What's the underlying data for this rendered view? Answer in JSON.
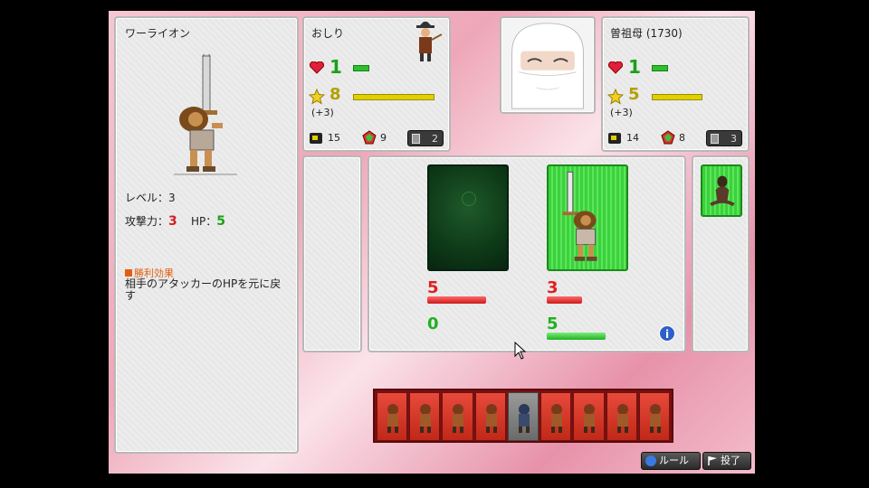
{
  "detail": {
    "card_name": "ワーライオン",
    "level_label": "レベル：",
    "level_value": "3",
    "attack_label": "攻撃力：",
    "attack_value": "3",
    "hp_label": "HP：",
    "hp_value": "5",
    "effect_title": "勝利効果",
    "effect_text": "相手のアタッカーのHPを元に戻す"
  },
  "player1": {
    "name": "おしり",
    "hp": "1",
    "hp_fraction": 0.2,
    "stars": "8",
    "star_fraction": 1.0,
    "bonus": "(+3)",
    "deck_count": "15",
    "gem_count": "9",
    "hand_count": "2"
  },
  "player2": {
    "name": "曽祖母 (1730)",
    "hp": "1",
    "hp_fraction": 0.2,
    "stars": "5",
    "star_fraction": 0.62,
    "bonus": "(+3)",
    "deck_count": "14",
    "gem_count": "8",
    "hand_count": "3"
  },
  "battle": {
    "left_attack": "5",
    "left_attack_fraction": 0.5,
    "left_hp": "0",
    "left_hp_fraction": 0.0,
    "right_attack": "3",
    "right_attack_fraction": 0.3,
    "right_hp": "5",
    "right_hp_fraction": 0.5,
    "info": "i"
  },
  "hand": {
    "cards": [
      "red",
      "red",
      "red",
      "red",
      "gray",
      "red",
      "red",
      "red",
      "red"
    ]
  },
  "buttons": {
    "rules": "ルール",
    "surrender": "投了"
  },
  "colors": {
    "hp": "#1aa01a",
    "attack": "#e02020",
    "star": "#e0d000",
    "background_pink": "#eea7b8"
  }
}
